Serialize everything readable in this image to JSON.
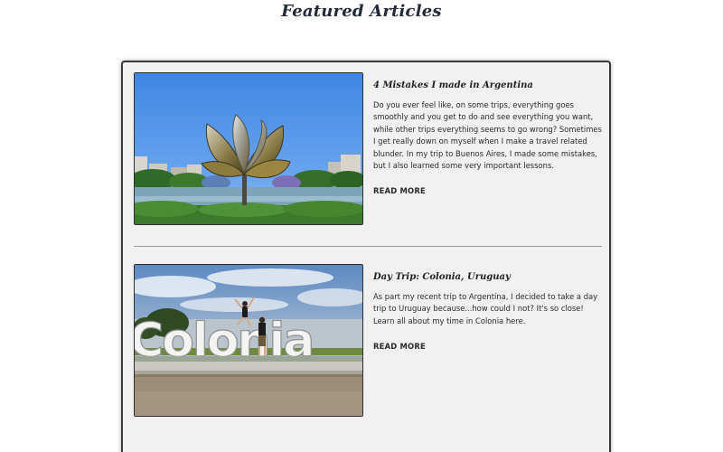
{
  "section": {
    "title": "Featured Articles"
  },
  "articles": [
    {
      "title": "4 Mistakes I made in Argentina",
      "excerpt": "Do you ever feel like, on some trips, everything goes smoothly and you get to do and see everything you want, while other trips everything seems to go wrong? Sometimes I get really down on myself when I make a travel related blunder. In my trip to Buenos Aires, I made some mistakes, but I also learned some very important lessons.",
      "read_more": "READ MORE",
      "image": "floralis-generica-sculpture-photo"
    },
    {
      "title": "Day Trip: Colonia, Uruguay",
      "excerpt": "As part my recent trip to Argentina, I decided to take a day trip to Uruguay because...how could I not? It's so close! Learn all about my time in Colonia here.",
      "read_more": "READ MORE",
      "image": "colonia-sign-photo"
    }
  ],
  "photo_sign_text": "Colonia",
  "colors": {
    "panel_background": "#f1f1f1",
    "panel_border": "#3a3a3a",
    "title_color": "#222a3a",
    "text_color": "#2a2a2a"
  }
}
